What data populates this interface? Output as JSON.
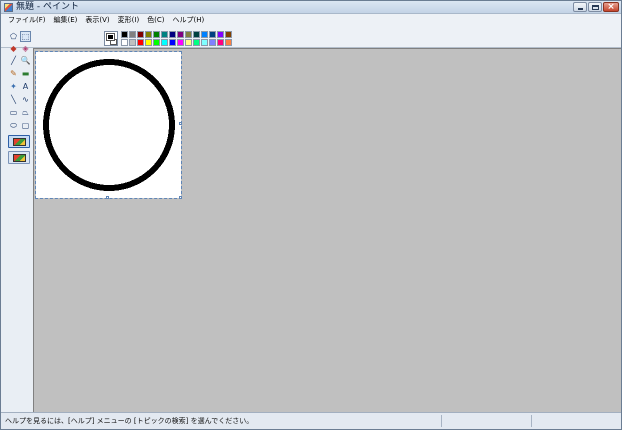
{
  "window": {
    "title": "無題 - ペイント"
  },
  "menu": [
    {
      "label": "ファイル(F)"
    },
    {
      "label": "編集(E)"
    },
    {
      "label": "表示(V)"
    },
    {
      "label": "変形(I)"
    },
    {
      "label": "色(C)"
    },
    {
      "label": "ヘルプ(H)"
    }
  ],
  "tools": [
    {
      "name": "free-select",
      "glyph": "⬠"
    },
    {
      "name": "rect-select",
      "glyph": "⬚"
    },
    {
      "name": "eraser",
      "glyph": "◆"
    },
    {
      "name": "fill",
      "glyph": "◈"
    },
    {
      "name": "color-picker",
      "glyph": "╱"
    },
    {
      "name": "magnifier",
      "glyph": "🔍"
    },
    {
      "name": "pencil",
      "glyph": "✎"
    },
    {
      "name": "brush",
      "glyph": "▬"
    },
    {
      "name": "airbrush",
      "glyph": "✦"
    },
    {
      "name": "text",
      "glyph": "A"
    },
    {
      "name": "line",
      "glyph": "╲"
    },
    {
      "name": "curve",
      "glyph": "∿"
    },
    {
      "name": "rectangle",
      "glyph": "▭"
    },
    {
      "name": "polygon",
      "glyph": "⏢"
    },
    {
      "name": "ellipse",
      "glyph": "⬭"
    },
    {
      "name": "rounded-rect",
      "glyph": "▢"
    }
  ],
  "palette": {
    "foreground": "#000000",
    "background": "#ffffff",
    "top_row": [
      "#000000",
      "#808080",
      "#800000",
      "#808000",
      "#008000",
      "#008080",
      "#000080",
      "#800080",
      "#808040",
      "#004040",
      "#0080ff",
      "#004080",
      "#8000ff",
      "#804000"
    ],
    "bottom_row": [
      "#ffffff",
      "#c0c0c0",
      "#ff0000",
      "#ffff00",
      "#00ff00",
      "#00ffff",
      "#0000ff",
      "#ff00ff",
      "#ffff80",
      "#00ff80",
      "#80ffff",
      "#8080ff",
      "#ff0080",
      "#ff8040"
    ]
  },
  "status": {
    "help_text": "ヘルプを見るには、[ヘルプ] メニューの [トピックの検索] を選んでください。"
  },
  "canvas": {
    "drawing": "black circle outline"
  }
}
